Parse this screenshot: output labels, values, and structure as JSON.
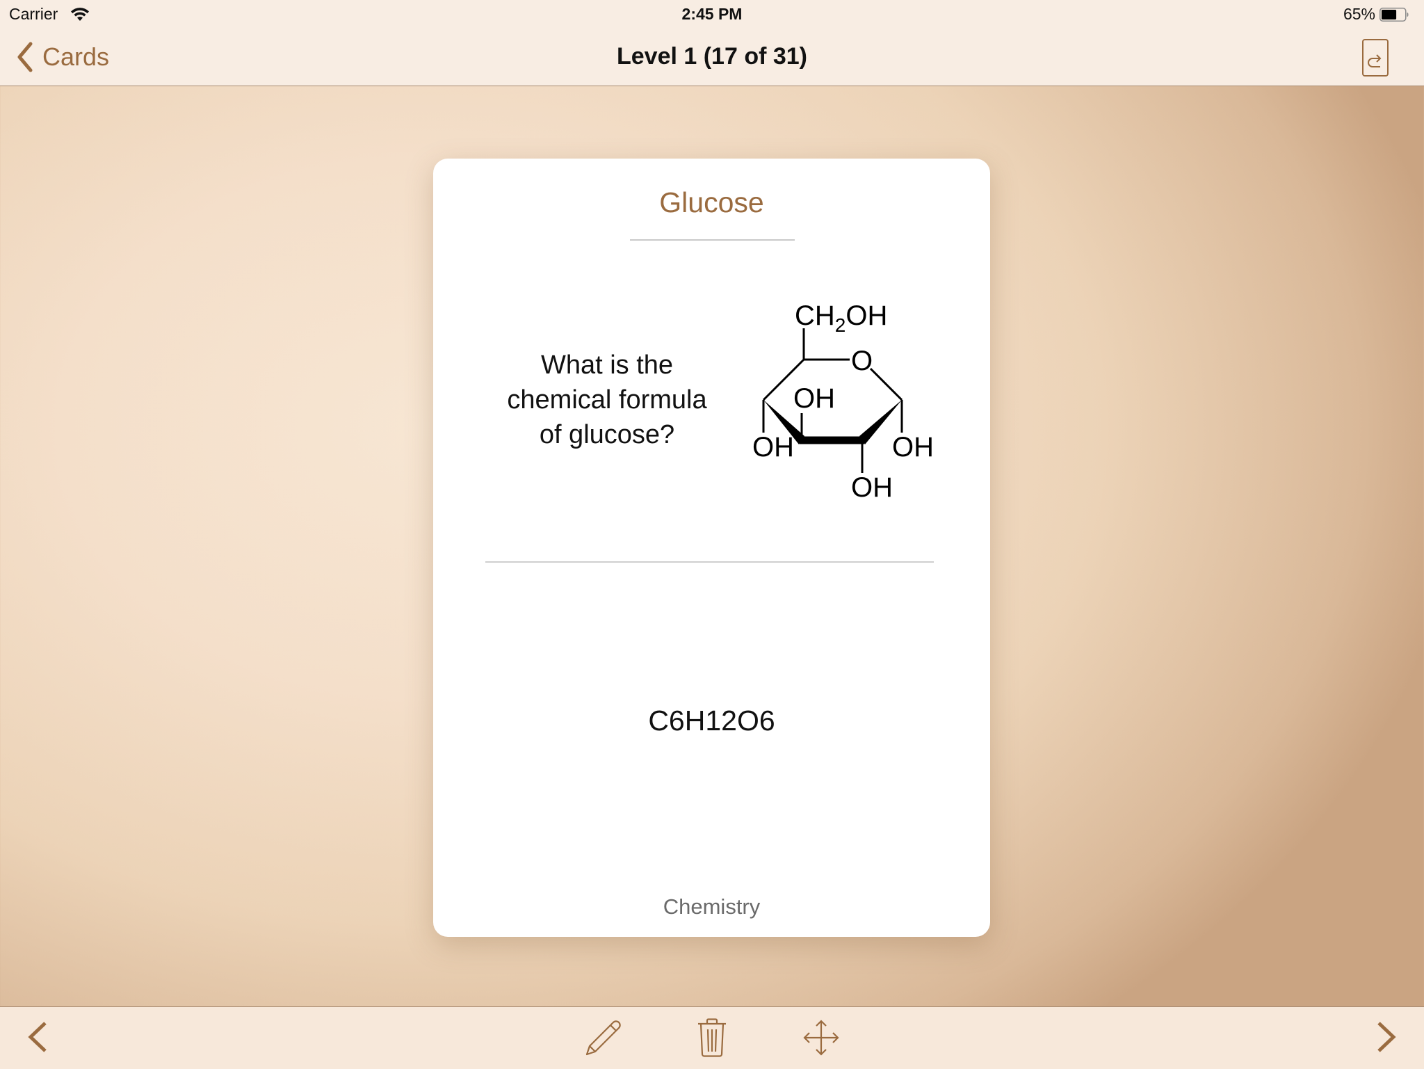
{
  "status_bar": {
    "carrier": "Carrier",
    "time": "2:45 PM",
    "battery_percent": "65%",
    "battery_level": 0.65,
    "icons": [
      "wifi-icon",
      "battery-icon"
    ]
  },
  "nav_bar": {
    "back_label": "Cards",
    "title": "Level 1 (17 of 31)",
    "icons": [
      "chevron-left-icon",
      "flip-card-icon"
    ]
  },
  "card": {
    "title": "Glucose",
    "question": "What is the chemical formula of glucose?",
    "structure_image": {
      "description": "glucose pyranose ring structure",
      "labels": {
        "ch2oh_main": "CH",
        "ch2oh_sub": "2",
        "ch2oh_end": "OH",
        "ring_oxygen": "O",
        "oh_inner": "OH",
        "oh_left": "OH",
        "oh_right": "OH",
        "oh_bottom": "OH"
      }
    },
    "answer": "C6H12O6",
    "category": "Chemistry"
  },
  "toolbar": {
    "icons": [
      "chevron-left-icon",
      "pencil-icon",
      "trash-icon",
      "move-icon",
      "chevron-right-icon"
    ]
  },
  "colors": {
    "accent": "#9a6b3f",
    "bar_background": "#f8ede3",
    "card_background": "#ffffff"
  }
}
